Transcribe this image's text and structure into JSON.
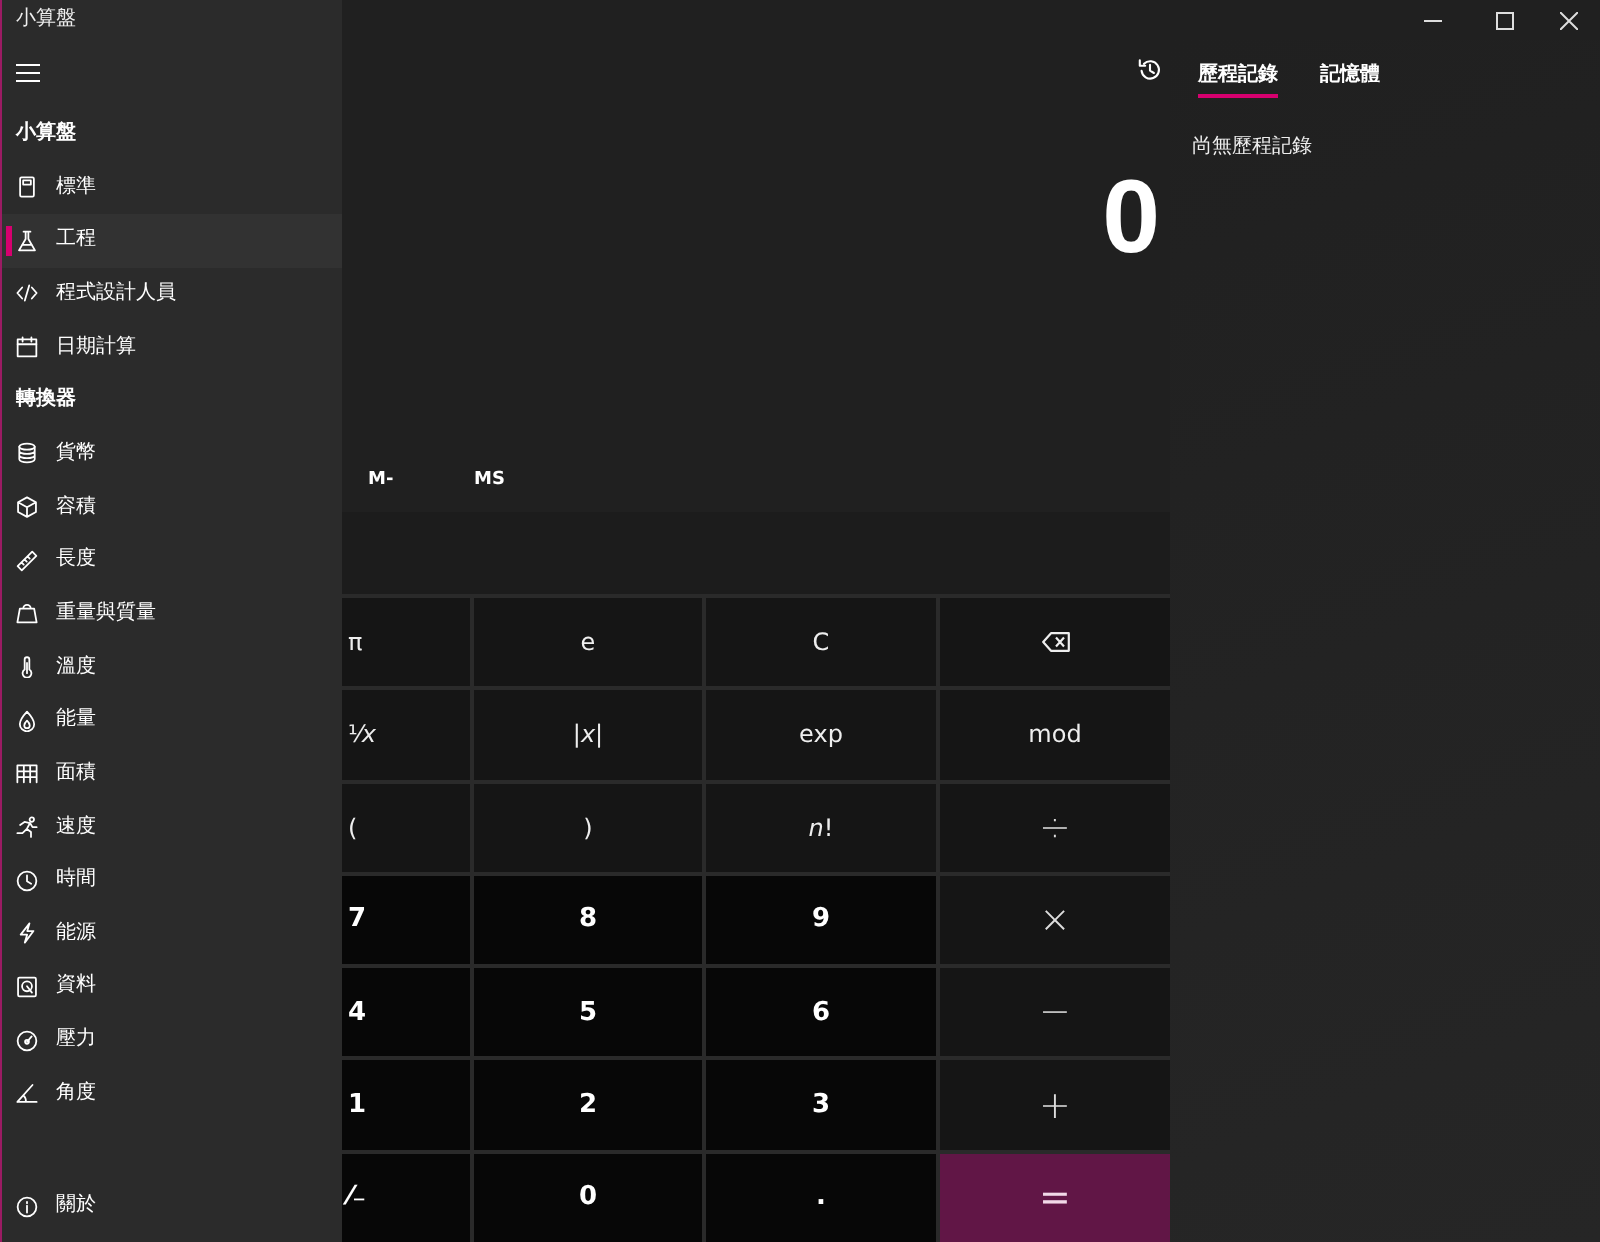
{
  "window": {
    "title": "小算盤"
  },
  "nav": {
    "sections": [
      {
        "heading": "小算盤",
        "items": [
          {
            "label": "標準",
            "selected": false
          },
          {
            "label": "工程",
            "selected": true
          },
          {
            "label": "程式設計人員",
            "selected": false
          },
          {
            "label": "日期計算",
            "selected": false
          }
        ]
      },
      {
        "heading": "轉換器",
        "items": [
          {
            "label": "貨幣",
            "selected": false
          },
          {
            "label": "容積",
            "selected": false
          },
          {
            "label": "長度",
            "selected": false
          },
          {
            "label": "重量與質量",
            "selected": false
          },
          {
            "label": "溫度",
            "selected": false
          },
          {
            "label": "能量",
            "selected": false
          },
          {
            "label": "面積",
            "selected": false
          },
          {
            "label": "速度",
            "selected": false
          },
          {
            "label": "時間",
            "selected": false
          },
          {
            "label": "能源",
            "selected": false
          },
          {
            "label": "資料",
            "selected": false
          },
          {
            "label": "壓力",
            "selected": false
          },
          {
            "label": "角度",
            "selected": false
          }
        ]
      }
    ],
    "footer_item": {
      "label": "關於",
      "selected": false
    }
  },
  "memory_buttons": [
    "M-",
    "MS"
  ],
  "display": {
    "value": "0"
  },
  "keypad": {
    "rows": [
      [
        {
          "kind": "function",
          "label": "π"
        },
        {
          "kind": "function",
          "label": "e"
        },
        {
          "kind": "function",
          "label": "C"
        },
        {
          "kind": "backspace"
        }
      ],
      [
        {
          "kind": "function",
          "label": "¹⁄*x*"
        },
        {
          "kind": "function",
          "label": "|*x*|"
        },
        {
          "kind": "function",
          "label": "exp"
        },
        {
          "kind": "function",
          "label": "mod"
        }
      ],
      [
        {
          "kind": "function",
          "label": "("
        },
        {
          "kind": "function",
          "label": ")"
        },
        {
          "kind": "function",
          "label": "*n*!"
        },
        {
          "kind": "operator",
          "label": "÷"
        }
      ],
      [
        {
          "kind": "digit",
          "label": "7"
        },
        {
          "kind": "digit",
          "label": "8"
        },
        {
          "kind": "digit",
          "label": "9"
        },
        {
          "kind": "operator",
          "label": "×"
        }
      ],
      [
        {
          "kind": "digit",
          "label": "4"
        },
        {
          "kind": "digit",
          "label": "5"
        },
        {
          "kind": "digit",
          "label": "6"
        },
        {
          "kind": "operator",
          "label": "−"
        }
      ],
      [
        {
          "kind": "digit",
          "label": "1"
        },
        {
          "kind": "digit",
          "label": "2"
        },
        {
          "kind": "digit",
          "label": "3"
        },
        {
          "kind": "operator",
          "label": "+"
        }
      ],
      [
        {
          "kind": "digit",
          "label": "⁄₋"
        },
        {
          "kind": "digit",
          "label": "0"
        },
        {
          "kind": "digit",
          "label": "."
        },
        {
          "kind": "equals",
          "label": "="
        }
      ]
    ]
  },
  "history": {
    "tabs": [
      {
        "label": "歷程記錄",
        "selected": true
      },
      {
        "label": "記憶體",
        "selected": false
      }
    ],
    "empty_message": "尚無歷程記錄"
  }
}
